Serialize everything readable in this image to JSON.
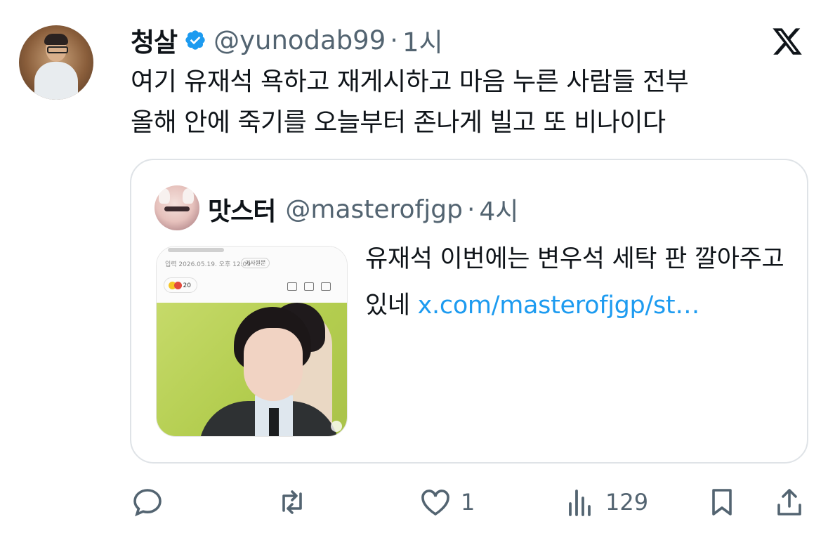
{
  "author": {
    "display_name": "청살",
    "handle": "@yunodab99",
    "separator": "·",
    "time": "1시",
    "verified": true
  },
  "tweet": {
    "text": "여기 유재석 욕하고 재게시하고 마음 누른 사람들 전부\n올해 안에 죽기를 오늘부터 존나게 빌고 또 비나이다"
  },
  "quote": {
    "display_name": "맛스터",
    "handle": "@masterofjgp",
    "separator": "·",
    "time": "4시",
    "text_before_link": "유재석 이번에는 변우석 세탁 판 깔아주고 있네 ",
    "link_text": "x.com/masterofjgp/st…",
    "thumbnail": {
      "meta": "입력 2026.05.19. 오후 12:09",
      "chip": "기사원문",
      "reaction_count": "20"
    }
  },
  "actions": {
    "replies": "",
    "retweets": "",
    "likes": "1",
    "views": "129"
  },
  "icons": {
    "brand": "x-logo-icon",
    "verified": "verified-badge-icon",
    "reply": "reply-icon",
    "retweet": "retweet-icon",
    "like": "heart-icon",
    "views": "views-icon",
    "bookmark": "bookmark-icon",
    "share": "share-icon"
  },
  "colors": {
    "accent": "#1d9bf0",
    "text": "#0f1419",
    "secondary": "#536471"
  }
}
